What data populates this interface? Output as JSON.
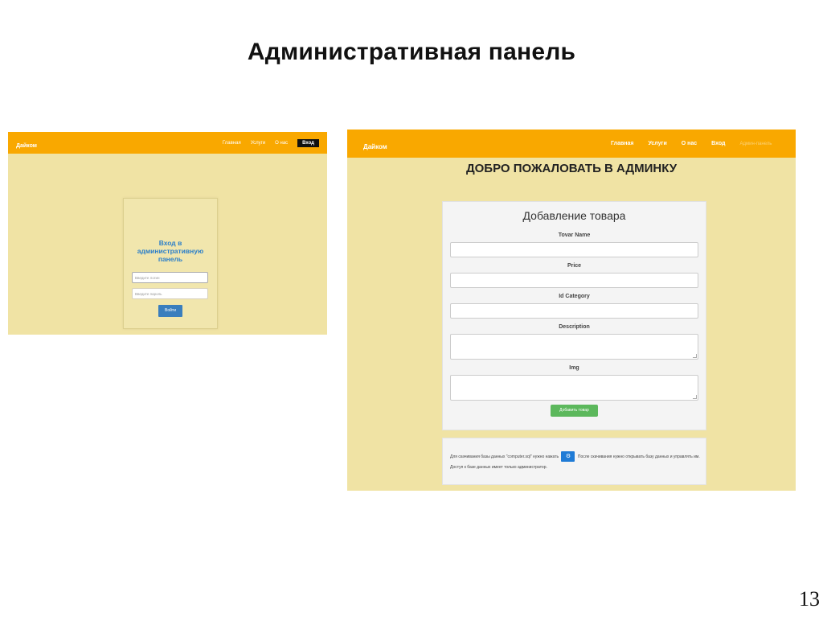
{
  "slide": {
    "title": "Административная панель",
    "page_number": "13"
  },
  "login_page": {
    "brand": "Дайком",
    "nav": [
      "Главная",
      "Услуги",
      "О нас",
      "Вход"
    ],
    "title_lines": [
      "Вход в",
      "административную",
      "панель"
    ],
    "login_placeholder": "Введите логин",
    "password_placeholder": "Введите пароль",
    "submit_label": "Войти"
  },
  "admin_page": {
    "brand": "Дайком",
    "nav": [
      "Главная",
      "Услуги",
      "О нас",
      "Вход",
      "Админ-панель"
    ],
    "welcome": "ДОБРО ПОЖАЛОВАТЬ В АДМИНКУ",
    "form_title": "Добавление товара",
    "fields": [
      "Tovar Name",
      "Price",
      "Id Category",
      "Description",
      "Img"
    ],
    "submit_label": "Добавить товар",
    "info_text_before": "Для скачивания базы данных \"computer.sql\" нужно нажать",
    "db_button_icon": "download-icon",
    "info_text_after": "После скачивания нужно открывать базу данных и управлять им. Доступ к базе данных имеет только администратор.",
    "colors": {
      "navbar": "#f9a800",
      "page_bg": "#f0e3a4",
      "login_title": "#2c7fc9",
      "login_button": "#3a7ebd",
      "add_button": "#5cb85c",
      "db_button": "#1f7bd6"
    }
  }
}
